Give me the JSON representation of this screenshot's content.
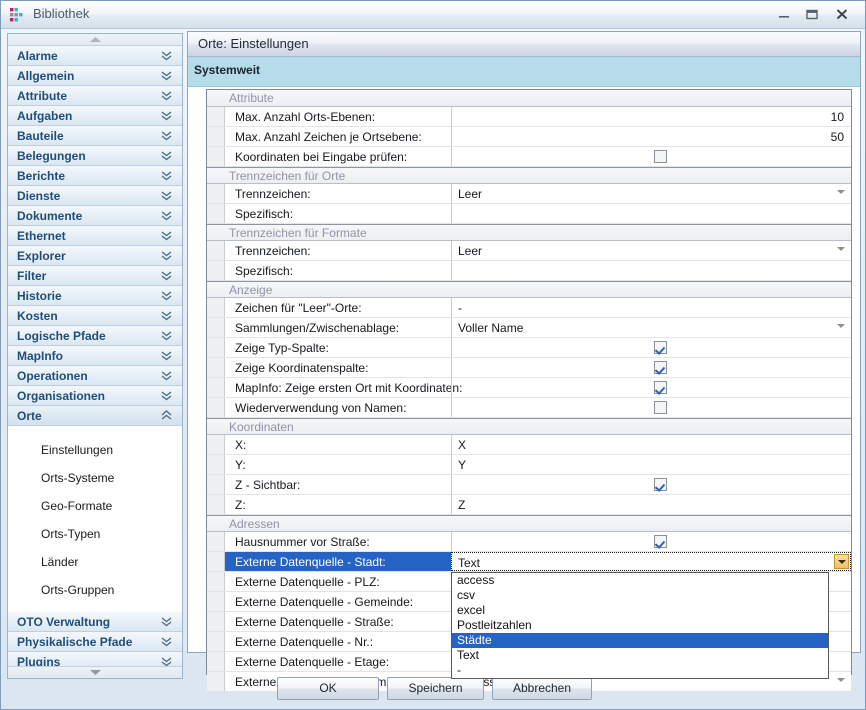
{
  "window": {
    "title": "Bibliothek",
    "icon": "app-dots-icon",
    "controls": {
      "minimize": "minimize-icon",
      "maximize": "maximize-icon",
      "close": "close-icon"
    }
  },
  "sidebar": {
    "scroll_up": "scroll-up-arrow",
    "scroll_down": "scroll-down-arrow",
    "groups": [
      {
        "label": "Alarme",
        "open": false
      },
      {
        "label": "Allgemein",
        "open": false
      },
      {
        "label": "Attribute",
        "open": false
      },
      {
        "label": "Aufgaben",
        "open": false
      },
      {
        "label": "Bauteile",
        "open": false
      },
      {
        "label": "Belegungen",
        "open": false
      },
      {
        "label": "Berichte",
        "open": false
      },
      {
        "label": "Dienste",
        "open": false
      },
      {
        "label": "Dokumente",
        "open": false
      },
      {
        "label": "Ethernet",
        "open": false
      },
      {
        "label": "Explorer",
        "open": false
      },
      {
        "label": "Filter",
        "open": false
      },
      {
        "label": "Historie",
        "open": false
      },
      {
        "label": "Kosten",
        "open": false
      },
      {
        "label": "Logische Pfade",
        "open": false
      },
      {
        "label": "MapInfo",
        "open": false
      },
      {
        "label": "Operationen",
        "open": false
      },
      {
        "label": "Organisationen",
        "open": false
      },
      {
        "label": "Orte",
        "open": true,
        "items": [
          "Einstellungen",
          "Orts-Systeme",
          "Geo-Formate",
          "Orts-Typen",
          "Länder",
          "Orts-Gruppen"
        ]
      },
      {
        "label": "OTO Verwaltung",
        "open": false
      },
      {
        "label": "Physikalische Pfade",
        "open": false
      },
      {
        "label": "Plugins",
        "open": false
      }
    ]
  },
  "main": {
    "header_title": "Orte: Einstellungen",
    "band_title": "Systemweit",
    "sections": [
      {
        "title": "Attribute",
        "rows": [
          {
            "label": "Max. Anzahl Orts-Ebenen:",
            "value": "10",
            "type": "number"
          },
          {
            "label": "Max. Anzahl Zeichen je Ortsebene:",
            "value": "50",
            "type": "number"
          },
          {
            "label": "Koordinaten bei Eingabe prüfen:",
            "value": "",
            "type": "checkbox",
            "checked": false
          }
        ]
      },
      {
        "title": "Trennzeichen für Orte",
        "rows": [
          {
            "label": "Trennzeichen:",
            "value": "Leer",
            "type": "combo"
          },
          {
            "label": "Spezifisch:",
            "value": "",
            "type": "text"
          }
        ]
      },
      {
        "title": "Trennzeichen für Formate",
        "rows": [
          {
            "label": "Trennzeichen:",
            "value": "Leer",
            "type": "combo"
          },
          {
            "label": "Spezifisch:",
            "value": "",
            "type": "text"
          }
        ]
      },
      {
        "title": "Anzeige",
        "rows": [
          {
            "label": "Zeichen für \"Leer\"-Orte:",
            "value": "-",
            "type": "text"
          },
          {
            "label": "Sammlungen/Zwischenablage:",
            "value": "Voller Name",
            "type": "combo"
          },
          {
            "label": "Zeige Typ-Spalte:",
            "value": "",
            "type": "checkbox",
            "checked": true
          },
          {
            "label": "Zeige Koordinatenspalte:",
            "value": "",
            "type": "checkbox",
            "checked": true
          },
          {
            "label": "MapInfo: Zeige ersten Ort mit Koordinaten:",
            "value": "",
            "type": "checkbox",
            "checked": true
          },
          {
            "label": "Wiederverwendung von Namen:",
            "value": "",
            "type": "checkbox",
            "checked": false
          }
        ]
      },
      {
        "title": "Koordinaten",
        "rows": [
          {
            "label": "X:",
            "value": "X",
            "type": "text"
          },
          {
            "label": "Y:",
            "value": "Y",
            "type": "text"
          },
          {
            "label": "Z - Sichtbar:",
            "value": "",
            "type": "checkbox",
            "checked": true
          },
          {
            "label": "Z:",
            "value": "Z",
            "type": "text"
          }
        ]
      },
      {
        "title": "Adressen",
        "rows": [
          {
            "label": "Hausnummer vor Straße:",
            "value": "",
            "type": "checkbox",
            "checked": true
          },
          {
            "label": "Externe Datenquelle - Stadt:",
            "value": "Text",
            "type": "combo-open",
            "selected": true
          },
          {
            "label": "Externe Datenquelle - PLZ:",
            "value": "",
            "type": "text"
          },
          {
            "label": "Externe Datenquelle - Gemeinde:",
            "value": "",
            "type": "text"
          },
          {
            "label": "Externe Datenquelle - Straße:",
            "value": "",
            "type": "text"
          },
          {
            "label": "Externe Datenquelle - Nr.:",
            "value": "",
            "type": "text"
          },
          {
            "label": "Externe Datenquelle - Etage:",
            "value": "",
            "type": "text"
          },
          {
            "label": "Externe Datenquelle - Raum:",
            "value": "access",
            "type": "combo"
          }
        ]
      }
    ],
    "dropdown": {
      "open": true,
      "options": [
        "access",
        "csv",
        "excel",
        "Postleitzahlen",
        "Städte",
        "Text",
        "-"
      ],
      "highlighted": "Städte"
    }
  },
  "buttons": {
    "ok": "OK",
    "save": "Speichern",
    "cancel": "Abbrechen"
  },
  "colors": {
    "accent_blue": "#2563c4",
    "band": "#b5dce8",
    "group_text": "#1f4e79",
    "combo_button": "#f2bf6b"
  }
}
